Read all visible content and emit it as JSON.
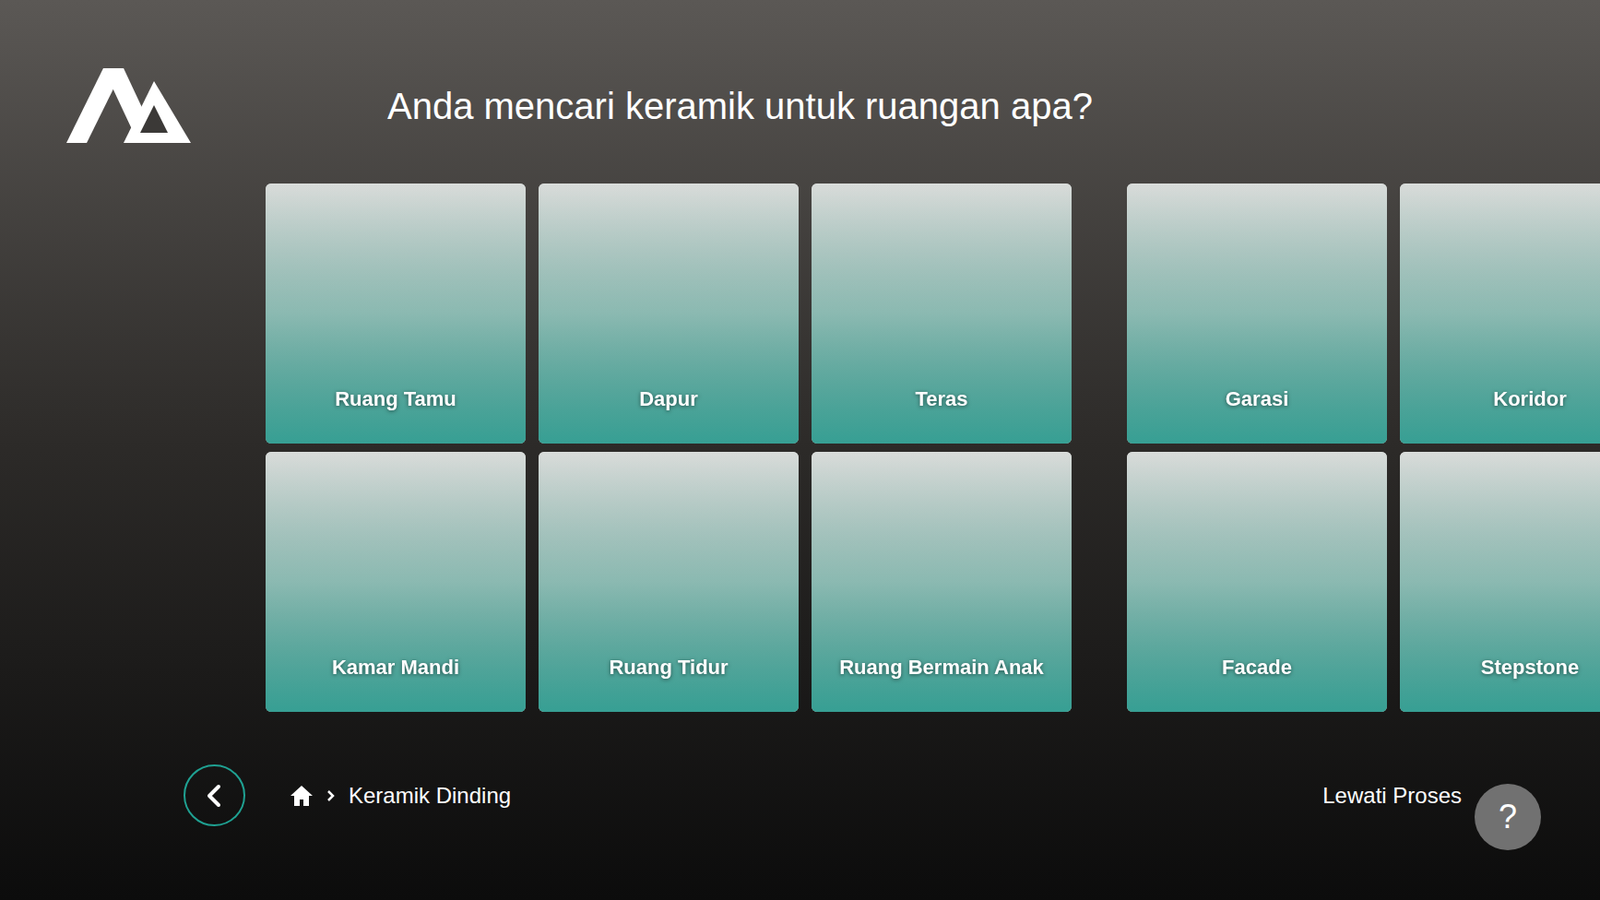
{
  "header": {
    "title": "Anda mencari keramik untuk ruangan apa?"
  },
  "rooms": {
    "rows": [
      [
        {
          "label": "Ruang Tamu"
        },
        {
          "label": "Dapur"
        },
        {
          "label": "Teras"
        },
        {
          "label": "Garasi"
        },
        {
          "label": "Koridor"
        }
      ],
      [
        {
          "label": "Kamar Mandi"
        },
        {
          "label": "Ruang Tidur"
        },
        {
          "label": "Ruang Bermain Anak"
        },
        {
          "label": "Facade"
        },
        {
          "label": "Stepstone"
        }
      ]
    ]
  },
  "breadcrumb": {
    "items": [
      "Keramik Dinding"
    ]
  },
  "skip_button": {
    "label": "Lewati Proses"
  },
  "help_button": {
    "label": "?"
  }
}
